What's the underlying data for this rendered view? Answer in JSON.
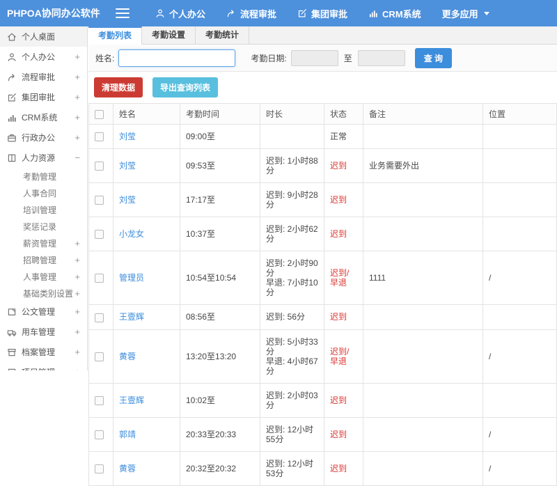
{
  "navbar": {
    "brand": "PHPOA协同办公软件",
    "items": [
      {
        "id": "personal-office",
        "label": "个人办公",
        "icon": "user"
      },
      {
        "id": "workflow-approval",
        "label": "流程审批",
        "icon": "share"
      },
      {
        "id": "group-approval",
        "label": "集团审批",
        "icon": "edit"
      },
      {
        "id": "crm-system",
        "label": "CRM系统",
        "icon": "chart"
      },
      {
        "id": "more-apps",
        "label": "更多应用",
        "icon": "",
        "caret": true
      }
    ]
  },
  "sidebar": {
    "items": [
      {
        "id": "personal-desktop",
        "label": "个人桌面",
        "icon": "home",
        "expand": "",
        "active": true
      },
      {
        "id": "personal-office",
        "label": "个人办公",
        "icon": "user",
        "expand": "+"
      },
      {
        "id": "workflow-approval",
        "label": "流程审批",
        "icon": "share",
        "expand": "+"
      },
      {
        "id": "group-approval",
        "label": "集团审批",
        "icon": "edit",
        "expand": "+"
      },
      {
        "id": "crm-system",
        "label": "CRM系统",
        "icon": "chart",
        "expand": "+"
      },
      {
        "id": "admin-office",
        "label": "行政办公",
        "icon": "briefcase",
        "expand": "+"
      },
      {
        "id": "human-resources",
        "label": "人力资源",
        "icon": "hr",
        "expand": "−",
        "children": [
          {
            "id": "attendance-management",
            "label": "考勤管理",
            "expand": ""
          },
          {
            "id": "personnel-contract",
            "label": "人事合同",
            "expand": ""
          },
          {
            "id": "training-management",
            "label": "培训管理",
            "expand": ""
          },
          {
            "id": "reward-records",
            "label": "奖惩记录",
            "expand": ""
          },
          {
            "id": "salary-management",
            "label": "薪资管理",
            "expand": "+"
          },
          {
            "id": "recruitment-management",
            "label": "招聘管理",
            "expand": "+"
          },
          {
            "id": "personnel-management",
            "label": "人事管理",
            "expand": "+"
          },
          {
            "id": "basic-category-settings",
            "label": "基础类别设置",
            "expand": "+"
          }
        ]
      },
      {
        "id": "document-management",
        "label": "公文管理",
        "icon": "doc",
        "expand": "+"
      },
      {
        "id": "vehicle-management",
        "label": "用车管理",
        "icon": "truck",
        "expand": "+"
      },
      {
        "id": "archive-management",
        "label": "档案管理",
        "icon": "archive",
        "expand": "+"
      },
      {
        "id": "project-management",
        "label": "项目管理",
        "icon": "list",
        "expand": "+"
      }
    ]
  },
  "tabs": [
    {
      "id": "attendance-list",
      "label": "考勤列表",
      "active": true
    },
    {
      "id": "attendance-setup",
      "label": "考勤设置",
      "active": false
    },
    {
      "id": "attendance-stats",
      "label": "考勤统计",
      "active": false
    }
  ],
  "search": {
    "name_label": "姓名:",
    "name_value": "",
    "date_label": "考勤日期:",
    "date_from": "",
    "to_label": "至",
    "date_to": "",
    "query_button": "查 询"
  },
  "actions": {
    "clean_button": "清理数据",
    "export_button": "导出查询列表"
  },
  "table": {
    "headers": [
      "姓名",
      "考勤时间",
      "时长",
      "状态",
      "备注",
      "位置"
    ],
    "rows": [
      {
        "name": "刘莹",
        "time": "09:00至",
        "duration": "",
        "status": "正常",
        "status_type": "normal",
        "note": "",
        "location": ""
      },
      {
        "name": "刘莹",
        "time": "09:53至",
        "duration": "迟到: 1小时88分",
        "status": "迟到",
        "status_type": "late",
        "note": "业务需要外出",
        "location": ""
      },
      {
        "name": "刘莹",
        "time": "17:17至",
        "duration": "迟到: 9小时28分",
        "status": "迟到",
        "status_type": "late",
        "note": "",
        "location": ""
      },
      {
        "name": "小龙女",
        "time": "10:37至",
        "duration": "迟到: 2小时62分",
        "status": "迟到",
        "status_type": "late",
        "note": "",
        "location": ""
      },
      {
        "name": "管理员",
        "time": "10:54至10:54",
        "duration": "迟到: 2小时90分\n早退: 7小时10分",
        "status": "迟到/早退",
        "status_type": "late",
        "note": "1111",
        "location": "/"
      },
      {
        "name": "王壹辉",
        "time": "08:56至",
        "duration": "迟到: 56分",
        "status": "迟到",
        "status_type": "late",
        "note": "",
        "location": ""
      },
      {
        "name": "黄蓉",
        "time": "13:20至13:20",
        "duration": "迟到: 5小时33分\n早退: 4小时67分",
        "status": "迟到/早退",
        "status_type": "late",
        "note": "",
        "location": "/"
      },
      {
        "name": "王壹辉",
        "time": "10:02至",
        "duration": "迟到: 2小时03分",
        "status": "迟到",
        "status_type": "late",
        "note": "",
        "location": ""
      },
      {
        "name": "郭靖",
        "time": "20:33至20:33",
        "duration": "迟到: 12小时55分",
        "status": "迟到",
        "status_type": "late",
        "note": "",
        "location": "/"
      },
      {
        "name": "黄蓉",
        "time": "20:32至20:32",
        "duration": "迟到: 12小时53分",
        "status": "迟到",
        "status_type": "late",
        "note": "",
        "location": "/"
      }
    ]
  },
  "colors": {
    "navbar_blue": "#4D90DC",
    "link_blue": "#3C8DDC",
    "status_red": "#D9342F",
    "clean_red": "#CC3B33",
    "export_cyan": "#59BFDE"
  }
}
